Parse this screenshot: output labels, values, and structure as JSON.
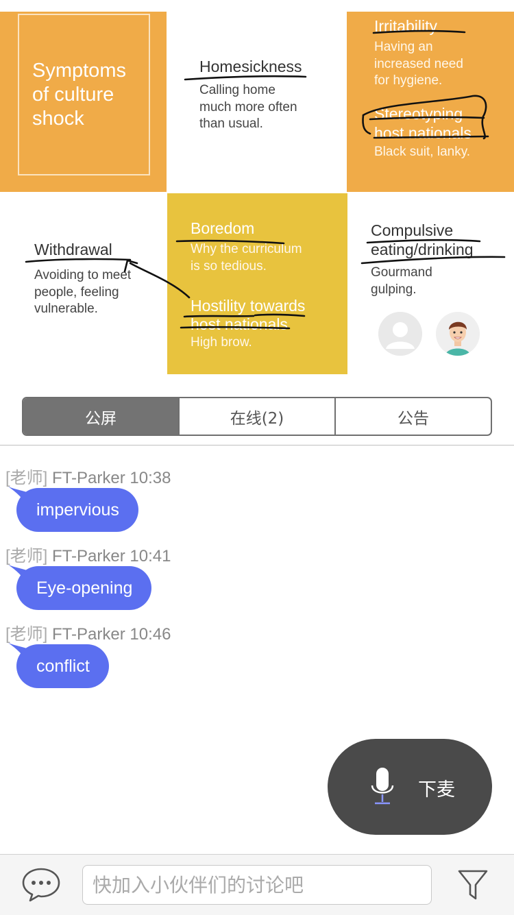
{
  "slide": {
    "title": "Symptoms\nof culture\nshock",
    "cards": [
      {
        "id": "homesickness",
        "heading": "Homesickness",
        "desc": "Calling home\nmuch more often\nthan usual."
      },
      {
        "id": "irritability",
        "heading": "Irritability",
        "desc": "Having an\nincreased need\nfor hygiene."
      },
      {
        "id": "stereotyping",
        "heading": "Stereotyping\nhost nationals",
        "desc": "Black suit, lanky."
      },
      {
        "id": "withdrawal",
        "heading": "Withdrawal",
        "desc": "Avoiding to meet\npeople, feeling\nvulnerable."
      },
      {
        "id": "boredom",
        "heading": "Boredom",
        "desc": "Why the curriculum\nis so tedious."
      },
      {
        "id": "hostility",
        "heading": "Hostility towards\nhost nationals",
        "desc": "High brow."
      },
      {
        "id": "compulsive",
        "heading": "Compulsive\neating/drinking",
        "desc": "Gourmand\ngulping."
      }
    ],
    "colors": {
      "orange": "#f0ab48",
      "yellow": "#e8c33e",
      "ink": "#111111"
    }
  },
  "tabs": [
    {
      "label": "公屏",
      "active": true
    },
    {
      "label": "在线(2)",
      "active": false
    },
    {
      "label": "公告",
      "active": false
    }
  ],
  "messages": [
    {
      "role": "[老师]",
      "sender": "FT-Parker",
      "time": "10:38",
      "text": "impervious"
    },
    {
      "role": "[老师]",
      "sender": "FT-Parker",
      "time": "10:41",
      "text": "Eye-opening"
    },
    {
      "role": "[老师]",
      "sender": "FT-Parker",
      "time": "10:46",
      "text": "conflict"
    }
  ],
  "mic": {
    "label": "下麦",
    "icon": "microphone-icon"
  },
  "input": {
    "placeholder": "快加入小伙伴们的讨论吧"
  },
  "icons": {
    "chat": "chat-bubble-icon",
    "filter": "filter-icon"
  },
  "colors": {
    "bubble": "#5b6ff0",
    "mic_bg": "#4a4a4a",
    "tab_active": "#737373"
  }
}
